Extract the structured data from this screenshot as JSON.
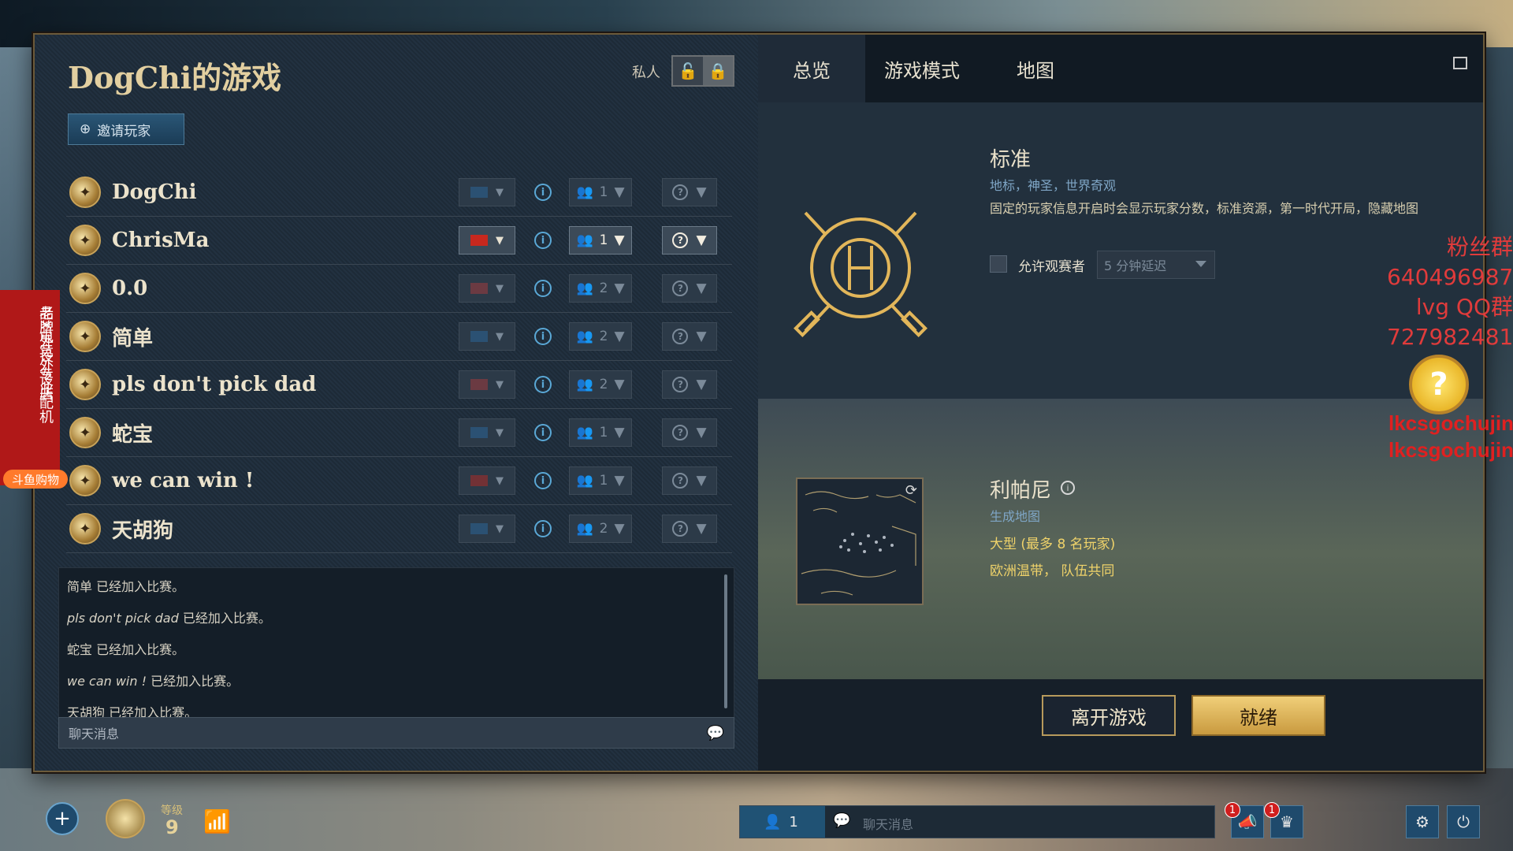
{
  "lobby": {
    "title": "DogChi的游戏",
    "private_label": "私人",
    "invite_label": "邀请玩家"
  },
  "players": [
    {
      "name": "DogChi",
      "flag_color": "#2b6ea8",
      "team": "1",
      "active": false
    },
    {
      "name": "ChrisMa",
      "flag_color": "#c8281e",
      "team": "1",
      "active": true
    },
    {
      "name": "0.0",
      "flag_color": "#b83c3c",
      "team": "2",
      "active": false
    },
    {
      "name": "简单",
      "flag_color": "#2b6ea8",
      "team": "2",
      "active": false
    },
    {
      "name": "pls don't pick dad",
      "flag_color": "#b83c3c",
      "team": "2",
      "active": false
    },
    {
      "name": "蛇宝",
      "flag_color": "#2b6ea8",
      "team": "1",
      "active": false
    },
    {
      "name": "we can win !",
      "flag_color": "#c8281e",
      "team": "1",
      "active": false
    },
    {
      "name": "天胡狗",
      "flag_color": "#2b6ea8",
      "team": "2",
      "active": false
    }
  ],
  "chat": {
    "lines": [
      {
        "name": "简单",
        "msg": "已经加入比赛。",
        "italic": false
      },
      {
        "name": "pls don't pick dad",
        "msg": "已经加入比赛。",
        "italic": true
      },
      {
        "name": "蛇宝",
        "msg": "已经加入比赛。",
        "italic": false
      },
      {
        "name": "we can win !",
        "msg": "已经加入比赛。",
        "italic": true
      },
      {
        "name": "天胡狗",
        "msg": "已经加入比赛。",
        "italic": false
      }
    ],
    "placeholder": "聊天消息"
  },
  "tabs": [
    {
      "label": "总览",
      "active": true
    },
    {
      "label": "游戏模式",
      "active": false
    },
    {
      "label": "地图",
      "active": false
    }
  ],
  "mode": {
    "name": "标准",
    "subtitle": "地标，神圣，世界奇观",
    "description": "固定的玩家信息开启时会显示玩家分数，标准资源，第一时代开局，隐藏地图",
    "spectator_label": "允许观赛者",
    "delay_value": "5 分钟延迟"
  },
  "map": {
    "name": "利帕尼",
    "subtitle": "生成地图",
    "size": "大型 (最多 8 名玩家)",
    "biome": "欧洲温带， 队伍共同"
  },
  "footer": {
    "leave_label": "离开游戏",
    "ready_label": "就绪"
  },
  "bottom_bar": {
    "level_label": "等级",
    "level_value": "9",
    "online_count": "1",
    "chat_placeholder": "聊天消息",
    "notif_a": "1",
    "notif_b": "1"
  },
  "overlay": {
    "ad_line1": "老X电竞外设店",
    "ad_line2": "品牌外设 专业配机",
    "ad_badge": "斗鱼购物",
    "fan_group": "粉丝群",
    "fan_number": "640496987",
    "qq_group": "lvg QQ群",
    "qq_number": "727982481",
    "streamer_1": "lkcsgochujin",
    "streamer_2": "lkcsgochujin"
  },
  "colors": {
    "accent_gold": "#c99a3f",
    "accent_blue": "#5aa8d6",
    "panel": "#1d2a37"
  }
}
